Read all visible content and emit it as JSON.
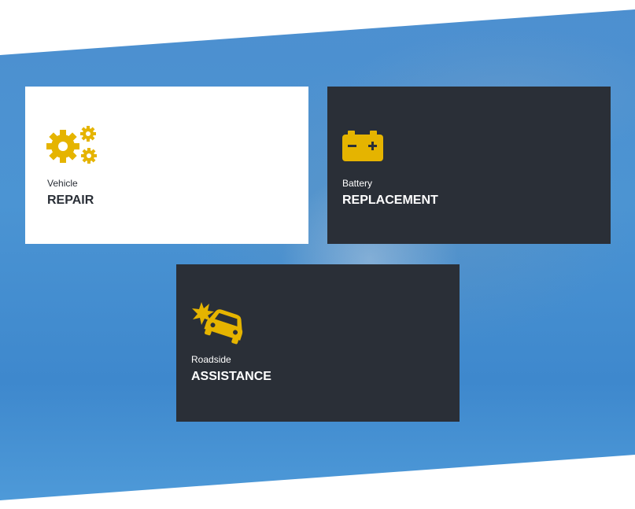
{
  "colors": {
    "accent": "#e5b400",
    "card_dark": "#2a2f37",
    "card_light": "#ffffff",
    "band": "#4b94d3"
  },
  "services": [
    {
      "icon": "gears-icon",
      "subtitle": "Vehicle",
      "title": "REPAIR"
    },
    {
      "icon": "battery-icon",
      "subtitle": "Battery",
      "title": "REPLACEMENT"
    },
    {
      "icon": "car-crash-icon",
      "subtitle": "Roadside",
      "title": "ASSISTANCE"
    }
  ]
}
